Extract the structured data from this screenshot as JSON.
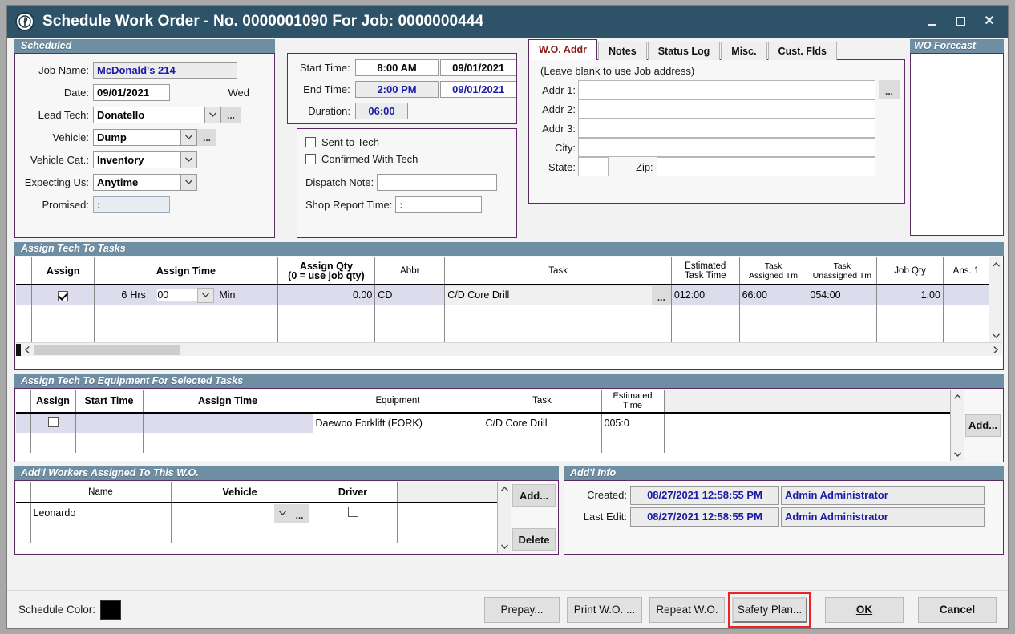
{
  "window": {
    "title": "Schedule Work Order - No. 0000001090 For Job: 0000000444",
    "minimize": "_",
    "maximize": "□",
    "close": "✕"
  },
  "scheduled": {
    "header": "Scheduled",
    "job_name_label": "Job Name:",
    "job_name_value": "McDonald's 214",
    "date_label": "Date:",
    "date_value": "09/01/2021",
    "date_weekday": "Wed",
    "lead_tech_label": "Lead Tech:",
    "lead_tech_value": "Donatello",
    "vehicle_label": "Vehicle:",
    "vehicle_value": "Dump",
    "vehicle_cat_label": "Vehicle Cat.:",
    "vehicle_cat_value": "Inventory",
    "expecting_us_label": "Expecting Us:",
    "expecting_us_value": "Anytime",
    "promised_label": "Promised:",
    "promised_value": ":",
    "ellipsis": "..."
  },
  "times": {
    "start_time_label": "Start Time:",
    "start_time_value": "8:00 AM",
    "start_date_value": "09/01/2021",
    "end_time_label": "End Time:",
    "end_time_value": "2:00 PM",
    "end_date_value": "09/01/2021",
    "duration_label": "Duration:",
    "duration_value": "06:00"
  },
  "dispatch": {
    "sent_to_tech_label": "Sent to Tech",
    "sent_to_tech_checked": false,
    "confirmed_with_tech_label": "Confirmed With Tech",
    "confirmed_with_tech_checked": false,
    "dispatch_note_label": "Dispatch Note:",
    "dispatch_note_value": "",
    "shop_report_time_label": "Shop Report Time:",
    "shop_report_time_value": ":"
  },
  "tabs": [
    {
      "label": "W.O. Addr",
      "active": true
    },
    {
      "label": "Notes",
      "active": false
    },
    {
      "label": "Status Log",
      "active": false
    },
    {
      "label": "Misc.",
      "active": false
    },
    {
      "label": "Cust. Flds",
      "active": false
    }
  ],
  "address": {
    "hint": "(Leave blank to use Job address)",
    "addr1_label": "Addr 1:",
    "addr1_value": "",
    "addr2_label": "Addr 2:",
    "addr2_value": "",
    "addr3_label": "Addr 3:",
    "addr3_value": "",
    "city_label": "City:",
    "city_value": "",
    "state_label": "State:",
    "state_value": "",
    "zip_label": "Zip:",
    "zip_value": "",
    "browse": "..."
  },
  "forecast": {
    "header": "WO Forecast",
    "content": ""
  },
  "tasks": {
    "header": "Assign Tech To Tasks",
    "columns": [
      "Assign",
      "Assign Time",
      "Assign Qty\n(0 = use job qty)",
      "Abbr",
      "Task",
      "Estimated\nTask Time",
      "Task\nAssigned Tm",
      "Task\nUnassigned Tm",
      "Job Qty",
      "Ans. 1"
    ],
    "col_assign": "Assign",
    "col_assign_time": "Assign Time",
    "col_assign_qty_l1": "Assign Qty",
    "col_assign_qty_l2": "(0 = use job qty)",
    "col_abbr": "Abbr",
    "col_task": "Task",
    "col_est_l1": "Estimated",
    "col_est_l2": "Task Time",
    "col_assigned_l1": "Task",
    "col_assigned_l2": "Assigned Tm",
    "col_unassigned_l1": "Task",
    "col_unassigned_l2": "Unassigned Tm",
    "col_job_qty": "Job Qty",
    "col_ans1": "Ans. 1",
    "row": {
      "assign_checked": true,
      "hours": "6",
      "hours_unit": "Hrs",
      "minutes": "00",
      "minutes_unit": "Min",
      "assign_qty": "0.00",
      "abbr": "CD",
      "task": "C/D Core Drill",
      "task_browse": "...",
      "estimated_task_time": "012:00",
      "task_assigned_tm": "66:00",
      "task_unassigned_tm": "054:00",
      "job_qty": "1.00",
      "ans1": ""
    }
  },
  "equipment": {
    "header": "Assign Tech To Equipment For Selected Tasks",
    "col_assign": "Assign",
    "col_start_time": "Start Time",
    "col_assign_time": "Assign Time",
    "col_equipment": "Equipment",
    "col_task": "Task",
    "col_est_l1": "Estimated",
    "col_est_l2": "Time",
    "row": {
      "assign_checked": false,
      "start_time": "",
      "assign_time": "",
      "equipment": "Daewoo Forklift (FORK)",
      "task": "C/D Core Drill",
      "estimated_time": "005:0"
    },
    "add_button": "Add..."
  },
  "workers": {
    "header": "Add'l Workers Assigned To This W.O.",
    "col_name": "Name",
    "col_vehicle": "Vehicle",
    "col_driver": "Driver",
    "row": {
      "name": "Leonardo",
      "vehicle": "",
      "driver_checked": false,
      "vehicle_browse": "..."
    },
    "add_button": "Add...",
    "delete_button": "Delete"
  },
  "addl_info": {
    "header": "Add'l Info",
    "created_label": "Created:",
    "created_date": "08/27/2021 12:58:55 PM",
    "created_user": "Admin Administrator",
    "last_edit_label": "Last Edit:",
    "last_edit_date": "08/27/2021 12:58:55 PM",
    "last_edit_user": "Admin Administrator"
  },
  "footer": {
    "schedule_color_label": "Schedule Color:",
    "schedule_color_value": "#000000",
    "prepay": "Prepay...",
    "print_wo": "Print W.O. ...",
    "repeat_wo": "Repeat W.O.",
    "safety_plan": "Safety Plan...",
    "ok": "OK",
    "cancel": "Cancel",
    "highlight_color": "#ee2222"
  }
}
